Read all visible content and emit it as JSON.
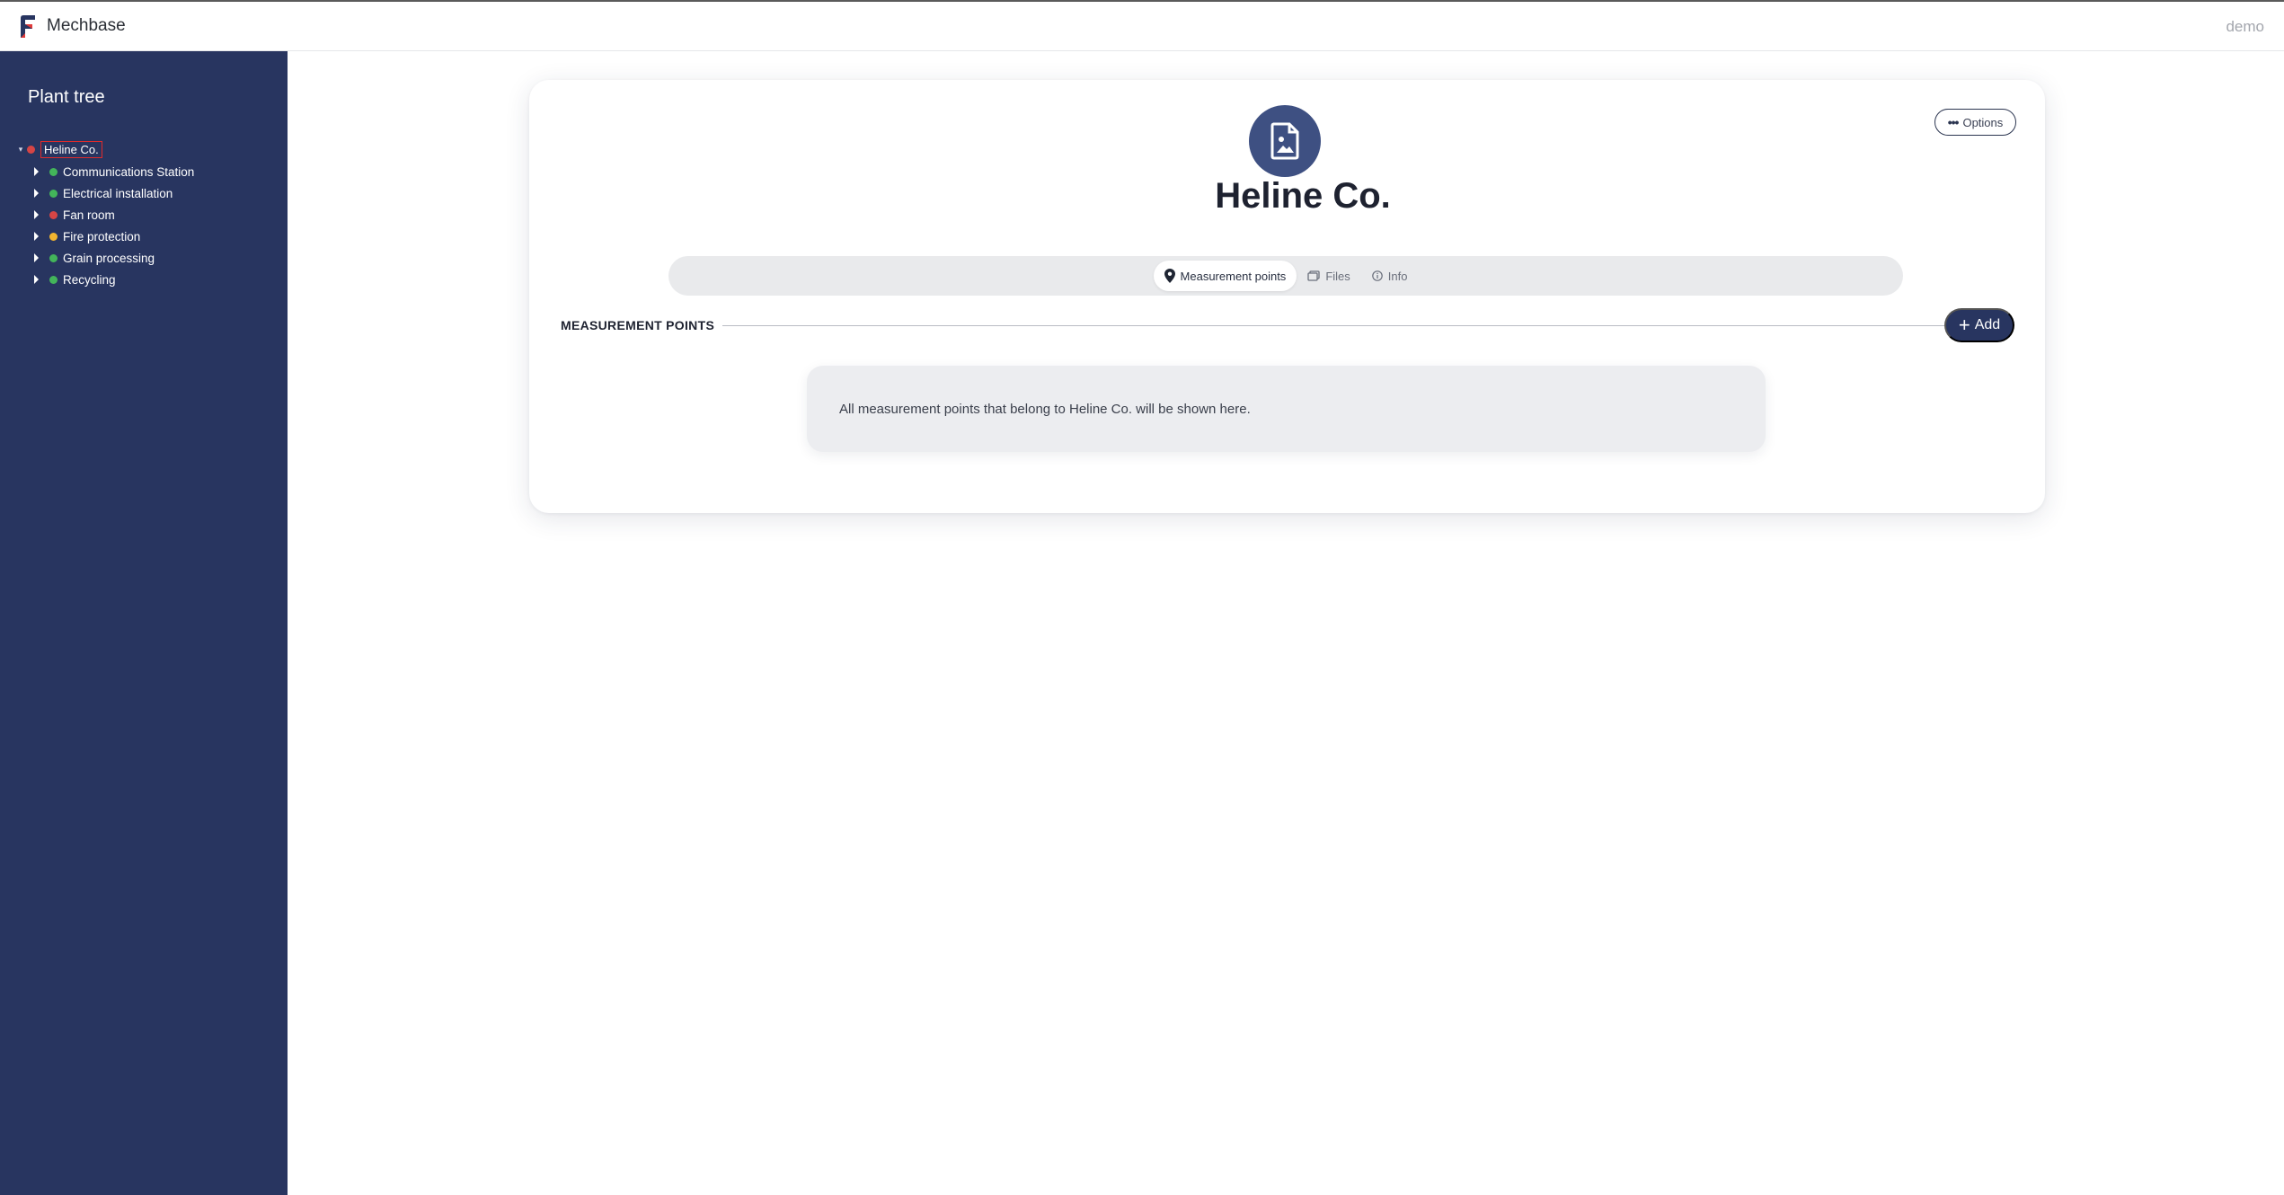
{
  "app": {
    "name": "Mechbase",
    "user": "demo"
  },
  "sidebar": {
    "title": "Plant tree",
    "root": {
      "label": "Heline Co.",
      "status_color": "#d64545"
    },
    "items": [
      {
        "label": "Communications Station",
        "status_color": "#43b55a"
      },
      {
        "label": "Electrical installation",
        "status_color": "#43b55a"
      },
      {
        "label": "Fan room",
        "status_color": "#d64545"
      },
      {
        "label": "Fire protection",
        "status_color": "#f2b530"
      },
      {
        "label": "Grain processing",
        "status_color": "#43b55a"
      },
      {
        "label": "Recycling",
        "status_color": "#43b55a"
      }
    ]
  },
  "main": {
    "title": "Heline Co.",
    "options_label": "Options",
    "tabs": [
      {
        "label": "Measurement points",
        "icon": "map-pin-icon",
        "active": true
      },
      {
        "label": "Files",
        "icon": "files-icon",
        "active": false
      },
      {
        "label": "Info",
        "icon": "info-icon",
        "active": false
      }
    ],
    "section_title": "MEASUREMENT POINTS",
    "add_label": "Add",
    "empty_message": "All measurement points that belong to Heline Co. will be shown here."
  },
  "colors": {
    "sidebar_bg": "#283560",
    "accent": "#283560",
    "avatar_bg": "#3e5082"
  }
}
